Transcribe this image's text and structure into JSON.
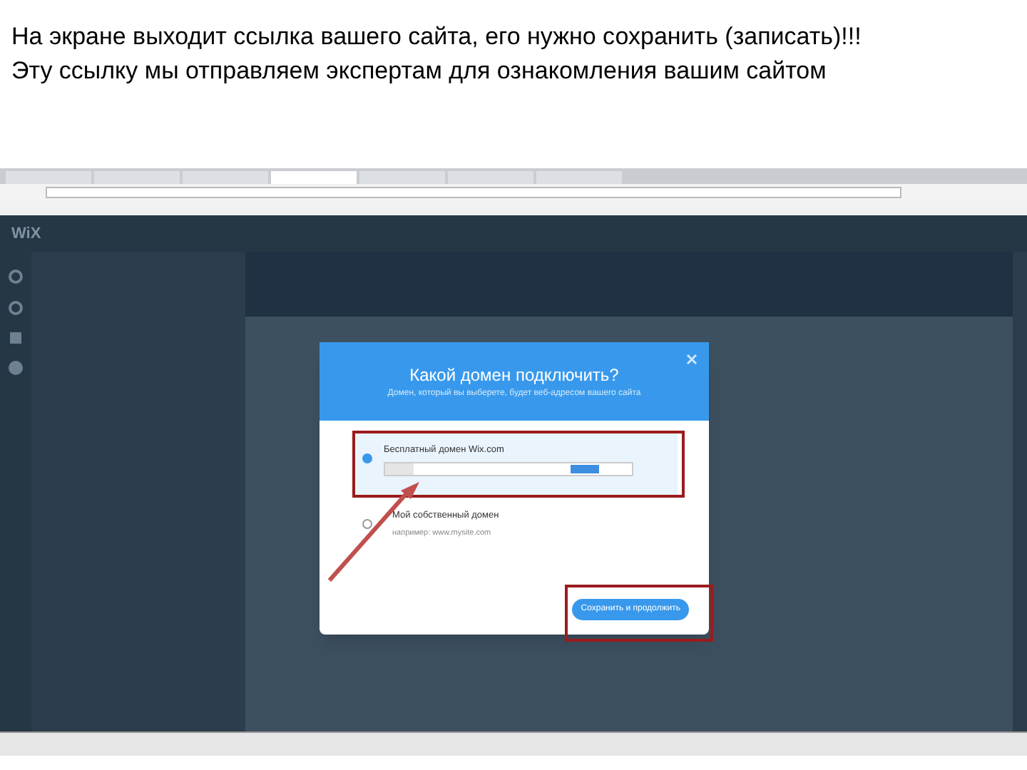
{
  "caption": [
    "На экране выходит ссылка вашего сайта, его нужно сохранить (записать)!!!",
    "Эту ссылку мы отправляем экспертам для ознакомления вашим сайтом"
  ],
  "editor": {
    "logo": "WiX"
  },
  "dialog": {
    "title": "Какой домен подключить?",
    "subtitle": "Домен, который вы выберете, будет веб-адресом вашего сайта",
    "options": [
      {
        "label": "Бесплатный домен Wix.com",
        "selected": true,
        "kind": "url"
      },
      {
        "label": "Мой собственный домен",
        "selected": false,
        "kind": "hint",
        "hint": "например: www.mysite.com"
      }
    ],
    "button": "Сохранить и продолжить"
  }
}
